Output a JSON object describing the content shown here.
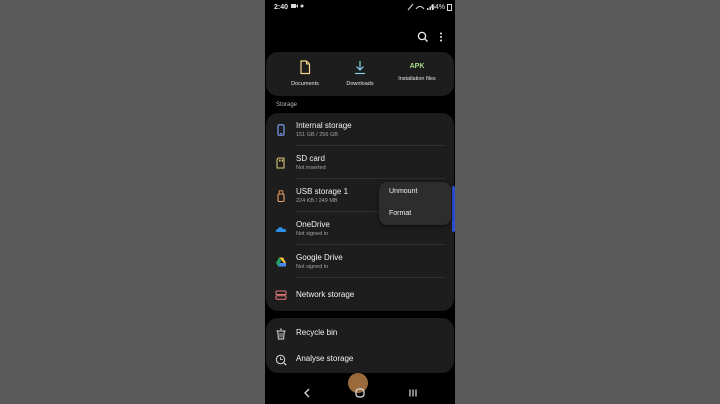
{
  "status_bar": {
    "time": "2:40",
    "battery": "64%"
  },
  "top_bar": {
    "search_icon": "search-icon",
    "more_icon": "more-vertical-icon"
  },
  "quick_access": [
    {
      "label": "Documents",
      "icon": "document-icon"
    },
    {
      "label": "Downloads",
      "icon": "download-icon"
    },
    {
      "label": "Installation files",
      "icon_text": "APK"
    }
  ],
  "storage_section_label": "Storage",
  "storage": [
    {
      "title": "Internal storage",
      "subtitle": "151 GB / 256 GB",
      "icon": "phone-icon"
    },
    {
      "title": "SD card",
      "subtitle": "Not inserted",
      "icon": "sd-card-icon"
    },
    {
      "title": "USB storage 1",
      "subtitle": "224 KB / 249 MB",
      "icon": "usb-icon"
    },
    {
      "title": "OneDrive",
      "subtitle": "Not signed in",
      "icon": "onedrive-icon"
    },
    {
      "title": "Google Drive",
      "subtitle": "Not signed in",
      "icon": "google-drive-icon"
    },
    {
      "title": "Network storage",
      "subtitle": "",
      "icon": "network-storage-icon"
    }
  ],
  "bottom_items": [
    {
      "title": "Recycle bin",
      "icon": "trash-icon"
    },
    {
      "title": "Analyse storage",
      "icon": "analyse-icon"
    }
  ],
  "popup_menu": {
    "items": [
      "Unmount",
      "Format"
    ]
  },
  "colors": {
    "usb_accent": "#f0a060",
    "phone_accent": "#7fa8ff",
    "scroll_handle": "#2c4fd6"
  }
}
